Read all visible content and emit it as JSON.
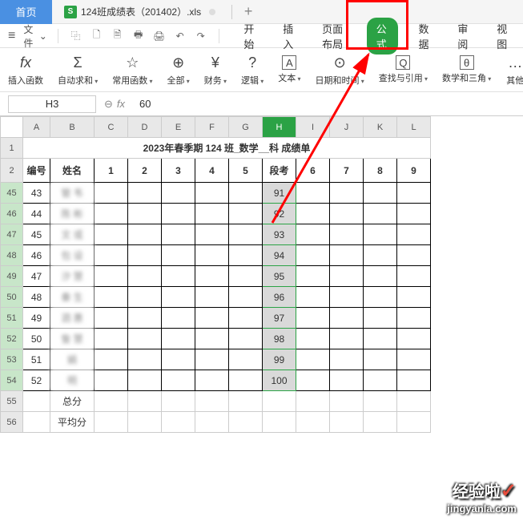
{
  "tabs": {
    "home": "首页",
    "file": "124班成绩表（201402）.xls",
    "new": "+"
  },
  "menu": {
    "menu_icon": "≡",
    "file_label": "文件",
    "qa": [
      "⿻",
      "🗋",
      "🗎",
      "🖶",
      "🖨",
      "↶",
      "↷"
    ]
  },
  "ribbon_tabs": [
    "开始",
    "插入",
    "页面布局",
    "公式",
    "数据",
    "审阅",
    "视图"
  ],
  "ribbon_items": [
    {
      "icon": "fx",
      "label": "插入函数"
    },
    {
      "icon": "Σ",
      "label": "自动求和"
    },
    {
      "icon": "☆",
      "label": "常用函数"
    },
    {
      "icon": "⊕",
      "label": "全部"
    },
    {
      "icon": "¥",
      "label": "财务"
    },
    {
      "icon": "?",
      "label": "逻辑"
    },
    {
      "icon": "A",
      "label": "文本"
    },
    {
      "icon": "⊙",
      "label": "日期和时间"
    },
    {
      "icon": "Q",
      "label": "查找与引用"
    },
    {
      "icon": "θ",
      "label": "数学和三角"
    },
    {
      "icon": "…",
      "label": "其他"
    }
  ],
  "ref": {
    "name_box": "H3",
    "zoom": "⊖",
    "fx": "fx",
    "value": "60"
  },
  "columns": [
    "A",
    "B",
    "C",
    "D",
    "E",
    "F",
    "G",
    "H",
    "I",
    "J",
    "K",
    "L"
  ],
  "title": "2023年春季期 124 班_数学__科 成绩单",
  "headers": [
    "编号",
    "姓名",
    "1",
    "2",
    "3",
    "4",
    "5",
    "段考",
    "6",
    "7",
    "8",
    "9"
  ],
  "rows": [
    {
      "r": "45",
      "num": "43",
      "name": "管   韦",
      "h": "91"
    },
    {
      "r": "46",
      "num": "44",
      "name": "陈   彬",
      "h": "92"
    },
    {
      "r": "47",
      "num": "45",
      "name": "文   或",
      "h": "93"
    },
    {
      "r": "48",
      "num": "46",
      "name": "包   设",
      "h": "94"
    },
    {
      "r": "49",
      "num": "47",
      "name": "汐   慧",
      "h": "95"
    },
    {
      "r": "50",
      "num": "48",
      "name": "秦   生",
      "h": "96"
    },
    {
      "r": "51",
      "num": "49",
      "name": "泗   惠",
      "h": "97"
    },
    {
      "r": "52",
      "num": "50",
      "name": "訾   慧",
      "h": "98"
    },
    {
      "r": "53",
      "num": "51",
      "name": "     娟",
      "h": "99"
    },
    {
      "r": "54",
      "num": "52",
      "name": "     明",
      "h": "100"
    }
  ],
  "footer_rows": [
    {
      "r": "55",
      "b": "总分"
    },
    {
      "r": "56",
      "b": "平均分"
    }
  ],
  "watermark": {
    "cn": "经验啦",
    "check": "✓",
    "en": "jingyanla.com"
  },
  "chart_data": {
    "type": "table",
    "title": "2023年春季期 124 班_数学__科 成绩单",
    "columns": [
      "编号",
      "姓名",
      "1",
      "2",
      "3",
      "4",
      "5",
      "段考",
      "6",
      "7",
      "8",
      "9"
    ],
    "visible_rows_segment_test": [
      {
        "编号": 43,
        "段考": 91
      },
      {
        "编号": 44,
        "段考": 92
      },
      {
        "编号": 45,
        "段考": 93
      },
      {
        "编号": 46,
        "段考": 94
      },
      {
        "编号": 47,
        "段考": 95
      },
      {
        "编号": 48,
        "段考": 96
      },
      {
        "编号": 49,
        "段考": 97
      },
      {
        "编号": 50,
        "段考": 98
      },
      {
        "编号": 51,
        "段考": 99
      },
      {
        "编号": 52,
        "段考": 100
      }
    ]
  }
}
